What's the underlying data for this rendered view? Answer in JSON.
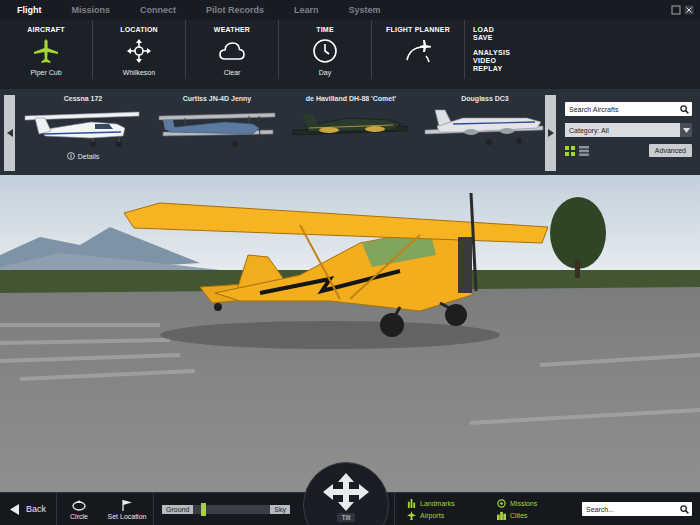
{
  "menu": [
    {
      "label": "Flight",
      "selected": true
    },
    {
      "label": "Missions",
      "selected": false
    },
    {
      "label": "Connect",
      "selected": false
    },
    {
      "label": "Pilot Records",
      "selected": false
    },
    {
      "label": "Learn",
      "selected": false
    },
    {
      "label": "System",
      "selected": false
    }
  ],
  "toolbar": [
    {
      "label": "AIRCRAFT",
      "value": "Piper Cub",
      "kind": "aircraft",
      "selected": true
    },
    {
      "label": "LOCATION",
      "value": "Whilkeson",
      "kind": "location",
      "selected": false
    },
    {
      "label": "WEATHER",
      "value": "Clear",
      "kind": "weather",
      "selected": false
    },
    {
      "label": "TIME",
      "value": "Day",
      "kind": "time",
      "selected": false
    },
    {
      "label": "FLIGHT PLANNER",
      "value": "",
      "kind": "planner",
      "selected": false
    }
  ],
  "file_actions": [
    "LOAD",
    "SAVE"
  ],
  "media_actions": [
    "ANALYSIS",
    "VIDEO",
    "REPLAY"
  ],
  "carousel": {
    "aircraft": [
      {
        "name": "Cessna 172",
        "kind": "monoplane",
        "details": "Details"
      },
      {
        "name": "Curtiss JN-4D Jenny",
        "kind": "biplane",
        "details": ""
      },
      {
        "name": "de Havilland DH-88 'Comet'",
        "kind": "racer",
        "details": ""
      },
      {
        "name": "Douglass DC3",
        "kind": "airliner",
        "details": ""
      }
    ],
    "search_placeholder": "Search Aircrafts",
    "category": "Category: All",
    "view_modes": [
      {
        "kind": "grid",
        "selected": true
      },
      {
        "kind": "list",
        "selected": false
      }
    ],
    "advanced": "Advanced"
  },
  "bottom_bar": {
    "back": "Back",
    "circle": "Circle",
    "set_location": "Set Location",
    "altitude": {
      "min": "Ground",
      "max": "Sky",
      "level": 0.12
    },
    "tilt": "Tilt",
    "layers": [
      [
        {
          "label": "Landmarks",
          "kind": "landmarks"
        },
        {
          "label": "Airports",
          "kind": "airports"
        }
      ],
      [
        {
          "label": "Missions",
          "kind": "missions"
        },
        {
          "label": "Cities",
          "kind": "cities"
        }
      ]
    ],
    "search_placeholder": "Search..."
  }
}
